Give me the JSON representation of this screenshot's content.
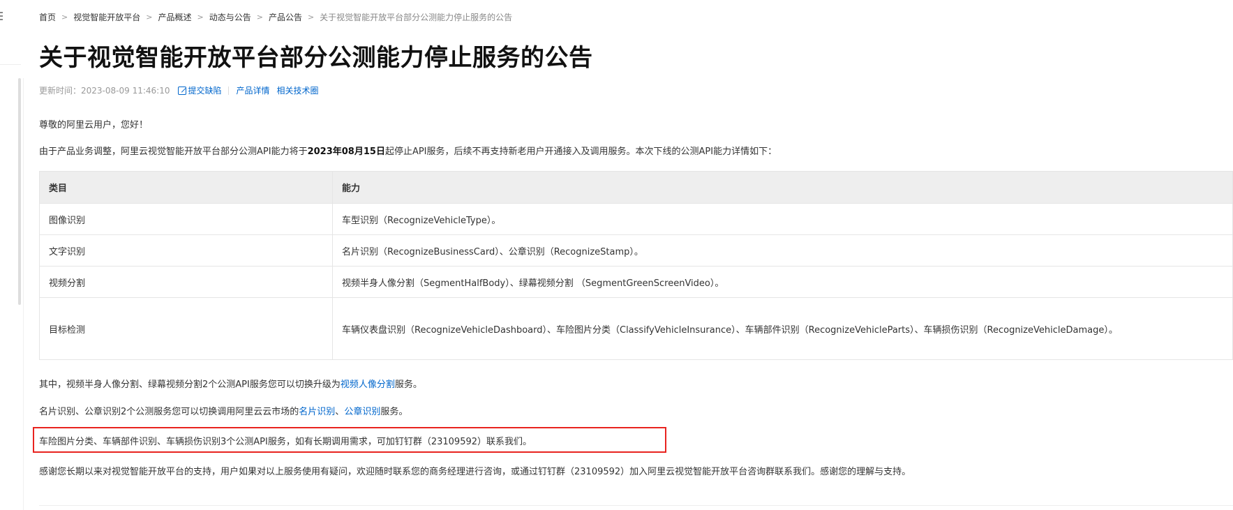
{
  "breadcrumb": [
    {
      "label": "首页"
    },
    {
      "label": "视觉智能开放平台"
    },
    {
      "label": "产品概述"
    },
    {
      "label": "动态与公告"
    },
    {
      "label": "产品公告"
    },
    {
      "label": "关于视觉智能开放平台部分公测能力停止服务的公告"
    }
  ],
  "title": "关于视觉智能开放平台部分公测能力停止服务的公告",
  "meta": {
    "updated_label": "更新时间：",
    "updated_value": "2023-08-09 11:46:10",
    "report_link": "提交缺陷",
    "product_link": "产品详情",
    "tech_link": "相关技术圈"
  },
  "greeting": "尊敬的阿里云用户，您好！",
  "intro": {
    "before": "由于产品业务调整，阿里云视觉智能开放平台部分公测API能力将于",
    "date": "2023年08月15日",
    "after": "起停止API服务，后续不再支持新老用户开通接入及调用服务。本次下线的公测API能力详情如下："
  },
  "table": {
    "headers": {
      "category": "类目",
      "capability": "能力"
    },
    "rows": [
      {
        "category": "图像识别",
        "capability": "车型识别（RecognizeVehicleType）。"
      },
      {
        "category": "文字识别",
        "capability": "名片识别（RecognizeBusinessCard）、公章识别（RecognizeStamp）。"
      },
      {
        "category": "视频分割",
        "capability": "视频半身人像分割（SegmentHalfBody）、绿幕视频分割 （SegmentGreenScreenVideo）。"
      },
      {
        "category": "目标检测",
        "capability": "车辆仪表盘识别（RecognizeVehicleDashboard）、车险图片分类（ClassifyVehicleInsurance）、车辆部件识别（RecognizeVehicleParts）、车辆损伤识别（RecognizeVehicleDamage）。"
      }
    ]
  },
  "note1": {
    "before": "其中，视频半身人像分割、绿幕视频分割2个公测API服务您可以切换升级为",
    "link": "视频人像分割",
    "after": "服务。"
  },
  "note2": {
    "before": "名片识别、公章识别2个公测服务您可以切换调用阿里云云市场的",
    "link1": "名片识别",
    "sep": "、",
    "link2": "公章识别",
    "after": "服务。"
  },
  "note3": "车险图片分类、车辆部件识别、车辆损伤识别3个公测API服务，如有长期调用需求，可加钉钉群（23109592）联系我们。",
  "closing": "感谢您长期以来对视觉智能开放平台的支持，用户如果对以上服务使用有疑问，欢迎随时联系您的商务经理进行咨询，或通过钉钉群（23109592）加入阿里云视觉智能开放平台咨询群联系我们。感谢您的理解与支持。",
  "colors": {
    "link": "#0066cc",
    "highlight": "#e8231f",
    "header_bg": "#eeeeee"
  }
}
